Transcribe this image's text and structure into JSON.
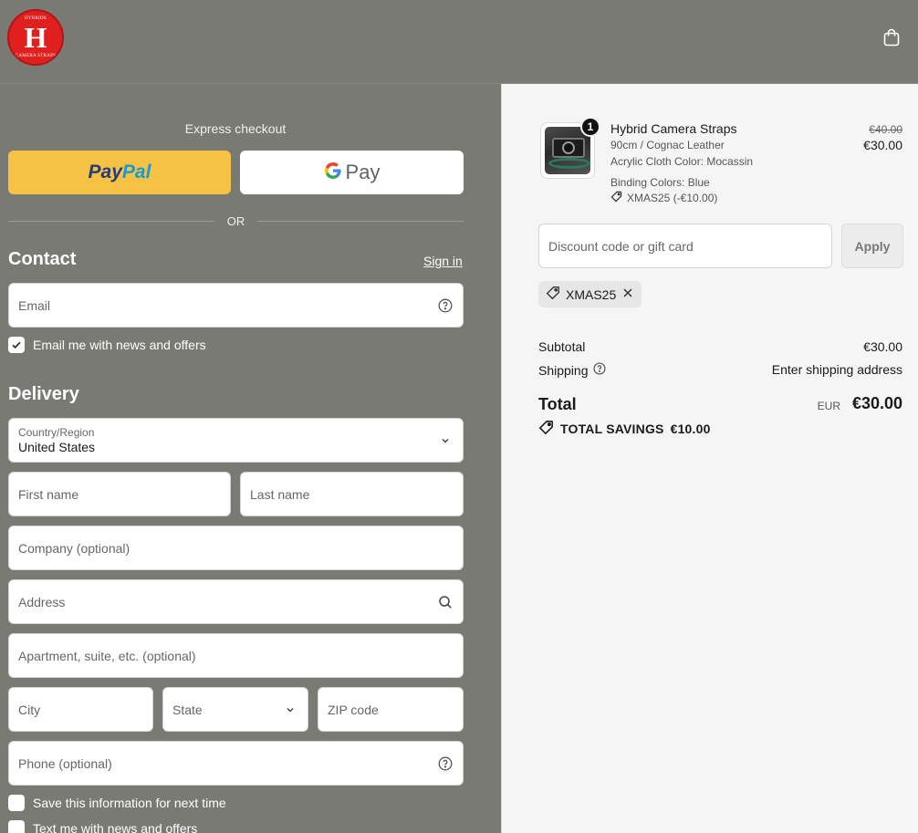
{
  "header": {
    "logo_text_top": "HYBRIDS",
    "logo_letter": "H",
    "logo_text_bottom": "CAMERA STRAPS",
    "cart_icon": "shopping-bag-icon"
  },
  "express": {
    "title": "Express checkout",
    "paypal_part1": "Pay",
    "paypal_part2": "Pal",
    "gpay_label": "Pay",
    "or_label": "OR"
  },
  "contact": {
    "title": "Contact",
    "sign_in": "Sign in",
    "email_placeholder": "Email",
    "newsletter_label": "Email me with news and offers",
    "newsletter_checked": true
  },
  "delivery": {
    "title": "Delivery",
    "country_label": "Country/Region",
    "country_value": "United States",
    "first_name": "First name",
    "last_name": "Last name",
    "company": "Company (optional)",
    "address": "Address",
    "apartment": "Apartment, suite, etc. (optional)",
    "city": "City",
    "state": "State",
    "zip": "ZIP code",
    "phone": "Phone (optional)",
    "save_info_label": "Save this information for next time",
    "text_offers_label": "Text me with news and offers"
  },
  "order": {
    "item": {
      "quantity": "1",
      "name": "Hybrid Camera Straps",
      "variant": "90cm / Cognac Leather",
      "cloth_color": "Acrylic Cloth Color: Mocassin",
      "binding_colors": "Binding Colors: Blue",
      "discount_code": "XMAS25 (-€10.00)",
      "original_price": "€40.00",
      "price": "€30.00"
    },
    "discount_placeholder": "Discount code or gift card",
    "apply_label": "Apply",
    "applied_code": "XMAS25",
    "subtotal_label": "Subtotal",
    "subtotal_value": "€30.00",
    "shipping_label": "Shipping",
    "shipping_value": "Enter shipping address",
    "total_label": "Total",
    "currency": "EUR",
    "total_value": "€30.00",
    "savings_label": "TOTAL SAVINGS",
    "savings_value": "€10.00"
  },
  "colors": {
    "paypal_yellow": "#f6c244",
    "logo_red": "#e0201f",
    "left_background": "#7a7a74",
    "right_background": "#f5f5f5"
  }
}
